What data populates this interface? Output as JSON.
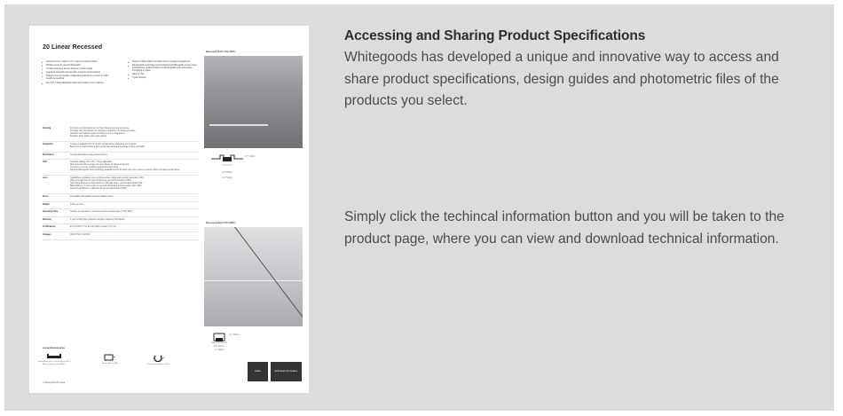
{
  "doc": {
    "title": "20 Linear Recessed",
    "features_left": [
      "Continuous line of light in a 0.7\" wide recessed luminaire",
      "Multiple lenses for general illumination",
      "Trimless and bezel trim for all types of hard ceilings",
      "Seamless integration into dry wall, wood and metal surfaces",
      "Straight runs and metallic configurations with factory corners in exact lengths as specified",
      "90+ CRI, 3 Steps MacAdam delivering excellent color rendering"
    ],
    "features_right": [
      "Choice of White 4000K and Warm Dim to emulate incandescent",
      "Identical LED technology used throughout all Whitegoods Linear, Cover, and Perimeter products deliver consistent quality and performance throughout a project",
      "Made in USA",
      "5 year warranty"
    ],
    "specs": [
      {
        "label": "Housing",
        "lines": [
          "Precision extruded aluminum for fixed dimensions and tolerances",
          "Provided with all hardware for seamless integration into selected surface",
          "Standard and tailored lengths including corner configurations",
          "Finishes: white, black, silver and custom"
        ]
      },
      {
        "label": "Integration",
        "lines": [
          "Trimless installation for 1/2\" & 5/8\" drywall without disrupting the structure",
          "Bezel trim for hard surfaces such as drywall, wood and specialty ceilings and walls"
        ]
      },
      {
        "label": "Distribution",
        "lines": [
          "General illumination using various lenses"
        ]
      },
      {
        "label": "LED",
        "lines": [
          "Constant Voltage, 90+ CRI, 3 Steps MacAdam",
          "LED tested to both average (not spec sheet) for delivered lumens",
          "Continuous runs are possible (against humidity / IEC)",
          "Identical Whitegoods LED technology available across all linear and cove systems ensures 100% consistent performance"
        ]
      },
      {
        "label": "Lens",
        "lines": [
          "Opal Diffuser provides even, continuous line of light and general illumination (OD)",
          "Micro prismatic lens for lower brightness, general illumination (MPL)",
          "Satin Clear Diffuser for high efficiency soft edge beam, general illumination (SD)",
          "Black Diffuser of color acrylic for general illumination and decorative effect (BD)",
          "Round Opal Diffuser 1\" diameter for general illumination (ROD)"
        ]
      },
      {
        "label": "Driver",
        "lines": [
          "Compatible with quality constant voltage drivers"
        ]
      },
      {
        "label": "Weight",
        "lines": [
          "0.3lbs per foot"
        ]
      },
      {
        "label": "Operating Temp",
        "lines": [
          "Suitable for operation in maximum ambient temperature of 35C (95F)"
        ]
      },
      {
        "label": "Warranty",
        "lines": [
          "5 year Limited (see complete company warranty information)"
        ]
      },
      {
        "label": "Certifications",
        "lines": [
          "ETL and ETL-C for dry and damp location / UL, CE"
        ]
      },
      {
        "label": "Voltages",
        "lines": [
          "100-277VAC, 347VAC"
        ]
      }
    ],
    "photo1_caption": "Recessed Flush Trim (RFT)",
    "photo2_caption": "Recessed Bezel Trim (RBT)",
    "profile1": {
      "top_dim": "0.7\" 18mm",
      "mid_dim": "0.9\" 24mm",
      "bottom_dim": "2.0\" 50mm"
    },
    "profile2": {
      "top_dim": "1.4\" 35mm",
      "mid_dim": "0.9\" 22mm",
      "bottom_dim": "1.1\" 28mm"
    },
    "lenses_title": "Lenses/Accessories",
    "lenses": [
      {
        "name": "Opal Diffuser (OD) / Satin Diffuser (SD) / Micro prismatic Lens (MPL)"
      },
      {
        "name": "Black Diffuser (BD)"
      },
      {
        "name": "Round Opal Diffuser (ROD)"
      }
    ],
    "footer": "1   Whitegoods 20 Linear",
    "index_button": "index",
    "tech_button": "technical information"
  },
  "heading": "Accessing and Sharing Product Specifications",
  "paragraph1": "Whitegoods has developed a unique and innovative way to access and share product specifications, design guides and photometric files of the products you select.",
  "paragraph2": "Simply click the techincal information button and you will be taken to the product page, where you can view and download technical information."
}
